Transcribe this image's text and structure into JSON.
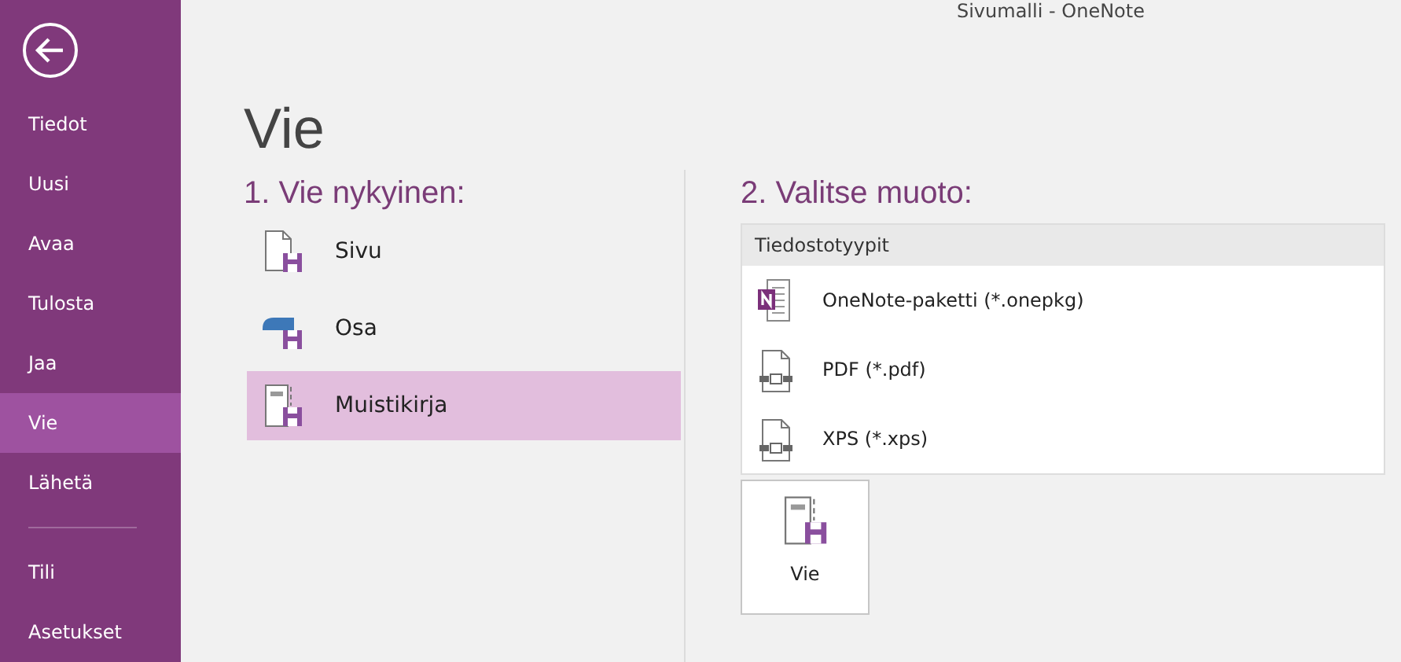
{
  "window": {
    "title": "Sivumalli - OneNote"
  },
  "sidebar": {
    "items": [
      {
        "label": "Tiedot",
        "selected": false
      },
      {
        "label": "Uusi",
        "selected": false
      },
      {
        "label": "Avaa",
        "selected": false
      },
      {
        "label": "Tulosta",
        "selected": false
      },
      {
        "label": "Jaa",
        "selected": false
      },
      {
        "label": "Vie",
        "selected": true
      },
      {
        "label": "Lähetä",
        "selected": false
      }
    ],
    "footer_items": [
      {
        "label": "Tili",
        "selected": false
      },
      {
        "label": "Asetukset",
        "selected": false
      }
    ]
  },
  "page_title": "Vie",
  "export_current": {
    "heading": "1. Vie nykyinen:",
    "items": [
      {
        "label": "Sivu",
        "kind": "page",
        "selected": false
      },
      {
        "label": "Osa",
        "kind": "section",
        "selected": false
      },
      {
        "label": "Muistikirja",
        "kind": "notebook",
        "selected": true
      }
    ]
  },
  "format": {
    "heading": "2. Valitse muoto:",
    "group_label": "Tiedostotyypit",
    "items": [
      {
        "label": "OneNote-paketti (*.onepkg)",
        "kind": "onepkg",
        "selected": false
      },
      {
        "label": "PDF (*.pdf)",
        "kind": "pdf",
        "selected": false
      },
      {
        "label": "XPS (*.xps)",
        "kind": "xps",
        "selected": false
      }
    ]
  },
  "export_button": {
    "label": "Vie"
  }
}
